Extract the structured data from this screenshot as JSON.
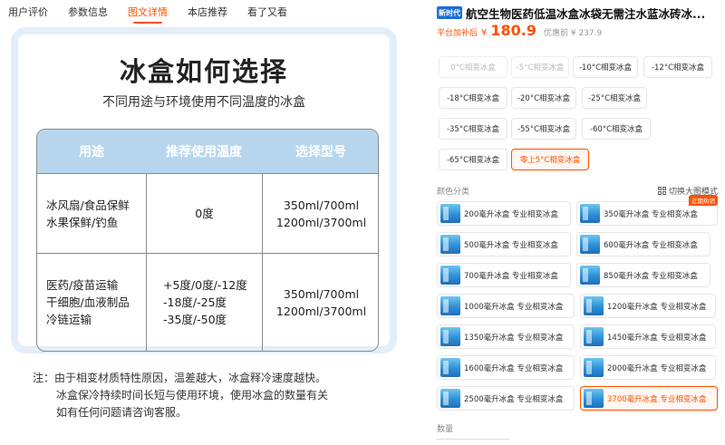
{
  "tabs": [
    {
      "label": "用户评价",
      "active": false
    },
    {
      "label": "参数信息",
      "active": false
    },
    {
      "label": "图文详情",
      "active": true
    },
    {
      "label": "本店推荐",
      "active": false
    },
    {
      "label": "看了又看",
      "active": false
    }
  ],
  "detail": {
    "title": "冰盒如何选择",
    "subtitle": "不同用途与环境使用不同温度的冰盒",
    "table": {
      "headers": [
        "用途",
        "推荐使用温度",
        "选择型号"
      ],
      "rows": [
        {
          "use": [
            "冰风扇/食品保鲜",
            "水果保鲜/钓鱼"
          ],
          "temp": [
            "0度"
          ],
          "model": [
            "350ml/700ml",
            "1200ml/3700ml"
          ]
        },
        {
          "use": [
            "医药/疫苗运输",
            "干细胞/血液制品",
            "冷链运输"
          ],
          "temp": [
            "+5度/0度/-12度",
            "-18度/-25度",
            "-35度/-50度"
          ],
          "model": [
            "350ml/700ml",
            "1200ml/3700ml"
          ]
        }
      ]
    },
    "note": [
      "注：由于相变材质特性原因，温差越大，冰盒释冷速度越快。",
      "冰盒保冷持续时间长短与使用环境，使用冰盒的数量有关",
      "如有任何问题请咨询客服。"
    ]
  },
  "product": {
    "badge": "新时代",
    "title": "航空生物医药低温冰盒冰袋无需注水蓝冰砖冰...",
    "price_label": "平台加补后",
    "currency": "¥",
    "price": "180.9",
    "orig_price": "优惠前 ¥ 237.9",
    "colors": {
      "accent": "#ff5000",
      "brand": "#1a6fd8"
    }
  },
  "temp_options": [
    {
      "label": "0°C相变冰盒",
      "state": "disabled"
    },
    {
      "label": "-5°C相变冰盒",
      "state": "disabled"
    },
    {
      "label": "-10°C相变冰盒",
      "state": "normal"
    },
    {
      "label": "-12°C相变冰盒",
      "state": "normal"
    },
    {
      "label": "-18°C相变冰盒",
      "state": "normal"
    },
    {
      "label": "-20°C相变冰盒",
      "state": "normal"
    },
    {
      "label": "-25°C相变冰盒",
      "state": "normal"
    },
    {
      "label": "-35°C相变冰盒",
      "state": "normal"
    },
    {
      "label": "-55°C相变冰盒",
      "state": "normal"
    },
    {
      "label": "-60°C相变冰盒",
      "state": "normal"
    },
    {
      "label": "-65°C相变冰盒",
      "state": "normal"
    },
    {
      "label": "零上5°C相变冰盒",
      "state": "selected"
    }
  ],
  "color_section": {
    "label": "颜色分类",
    "switch_label": "切换大图模式",
    "options": [
      {
        "label": "200毫升冰盒 专业相变冰盒",
        "selected": false,
        "hot": ""
      },
      {
        "label": "350毫升冰盒 专业相变冰盒",
        "selected": false,
        "hot": "近期热销"
      },
      {
        "label": "500毫升冰盒 专业相变冰盒",
        "selected": false,
        "hot": ""
      },
      {
        "label": "600毫升冰盒 专业相变冰盒",
        "selected": false,
        "hot": ""
      },
      {
        "label": "700毫升冰盒 专业相变冰盒",
        "selected": false,
        "hot": ""
      },
      {
        "label": "850毫升冰盒 专业相变冰盒",
        "selected": false,
        "hot": ""
      },
      {
        "label": "1000毫升冰盒 专业相变冰盒",
        "selected": false,
        "hot": ""
      },
      {
        "label": "1200毫升冰盒 专业相变冰盒",
        "selected": false,
        "hot": ""
      },
      {
        "label": "1350毫升冰盒 专业相变冰盒",
        "selected": false,
        "hot": ""
      },
      {
        "label": "1450毫升冰盒 专业相变冰盒",
        "selected": false,
        "hot": ""
      },
      {
        "label": "1600毫升冰盒 专业相变冰盒",
        "selected": false,
        "hot": ""
      },
      {
        "label": "2000毫升冰盒 专业相变冰盒",
        "selected": false,
        "hot": ""
      },
      {
        "label": "2500毫升冰盒 专业相变冰盒",
        "selected": false,
        "hot": ""
      },
      {
        "label": "3700毫升冰盒 专业相变冰盒",
        "selected": true,
        "hot": ""
      }
    ]
  },
  "quantity": {
    "label": "数量"
  }
}
